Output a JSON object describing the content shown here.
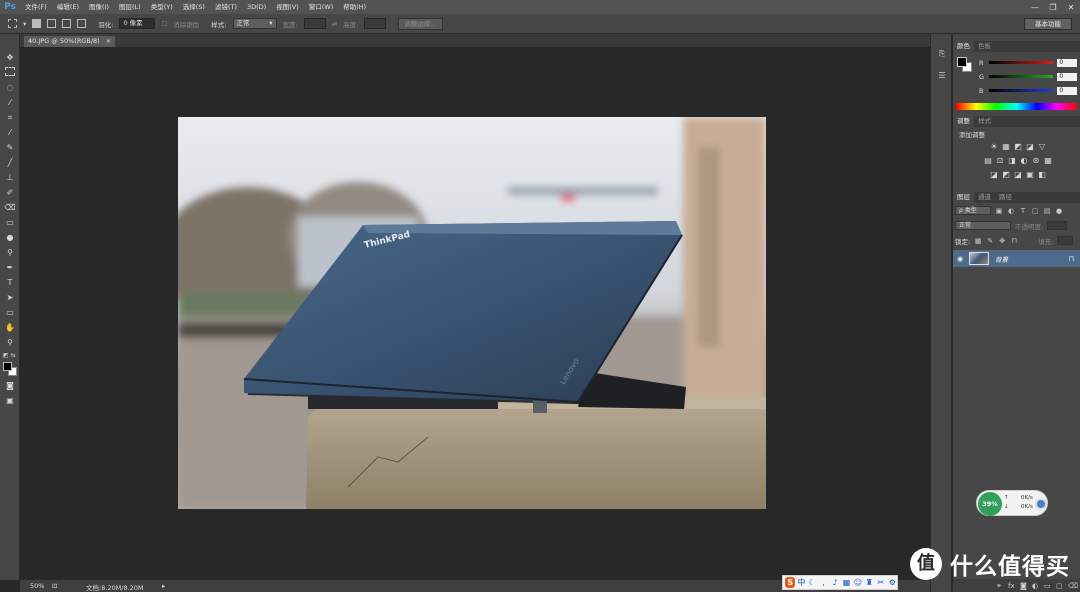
{
  "app": {
    "logo": "Ps"
  },
  "menu": [
    "文件(F)",
    "编辑(E)",
    "图像(I)",
    "图层(L)",
    "类型(Y)",
    "选择(S)",
    "滤镜(T)",
    "3D(D)",
    "视图(V)",
    "窗口(W)",
    "帮助(H)"
  ],
  "window_controls": [
    "—",
    "❐",
    "✕"
  ],
  "options": {
    "feather_label": "羽化:",
    "feather_value": "0 像素",
    "antialias_label": "消除锯齿",
    "style_label": "样式:",
    "style_value": "正常",
    "width_label": "宽度:",
    "height_label": "高度:",
    "refine_edge": "调整边缘...",
    "workspace": "基本功能"
  },
  "document": {
    "tab_title": "40.JPG @ 50%(RGB/8)",
    "close": "×",
    "zoom": "50%",
    "doc_info": "文档:8.20M/8.20M",
    "laptop_logo": "ThinkPad",
    "laptop_brand": "Lenovo"
  },
  "color_panel": {
    "tabs": [
      "颜色",
      "色板"
    ],
    "channels": [
      {
        "label": "R",
        "value": "0",
        "color": "#d22020"
      },
      {
        "label": "G",
        "value": "0",
        "color": "#20b020"
      },
      {
        "label": "B",
        "value": "0",
        "color": "#2040d0"
      }
    ]
  },
  "adjust_panel": {
    "tabs": [
      "调整",
      "样式"
    ],
    "add_label": "添加调整",
    "icon_rows": [
      [
        "☀",
        "▦",
        "◩",
        "◪",
        "▽"
      ],
      [
        "▤",
        "⚖",
        "◨",
        "◐",
        "⊛",
        "▦"
      ],
      [
        "◪",
        "◩",
        "◪",
        "▣",
        "◧"
      ]
    ]
  },
  "layers_panel": {
    "tabs": [
      "图层",
      "通道",
      "路径"
    ],
    "filter_label": "ρ 类型",
    "blend_mode": "正常",
    "opacity_label": "不透明度:",
    "lock_label": "锁定:",
    "fill_label": "填充:",
    "layer_name": "背景"
  },
  "net_widget": {
    "percent": "39%",
    "up": "0K/s",
    "down": "0K/s"
  },
  "watermark": {
    "logo": "值",
    "text": "什么值得买"
  },
  "colors": {
    "accent": "#4aa3df",
    "panel": "#474747",
    "canvas": "#282828",
    "layer_selected": "#4f6b8c"
  }
}
